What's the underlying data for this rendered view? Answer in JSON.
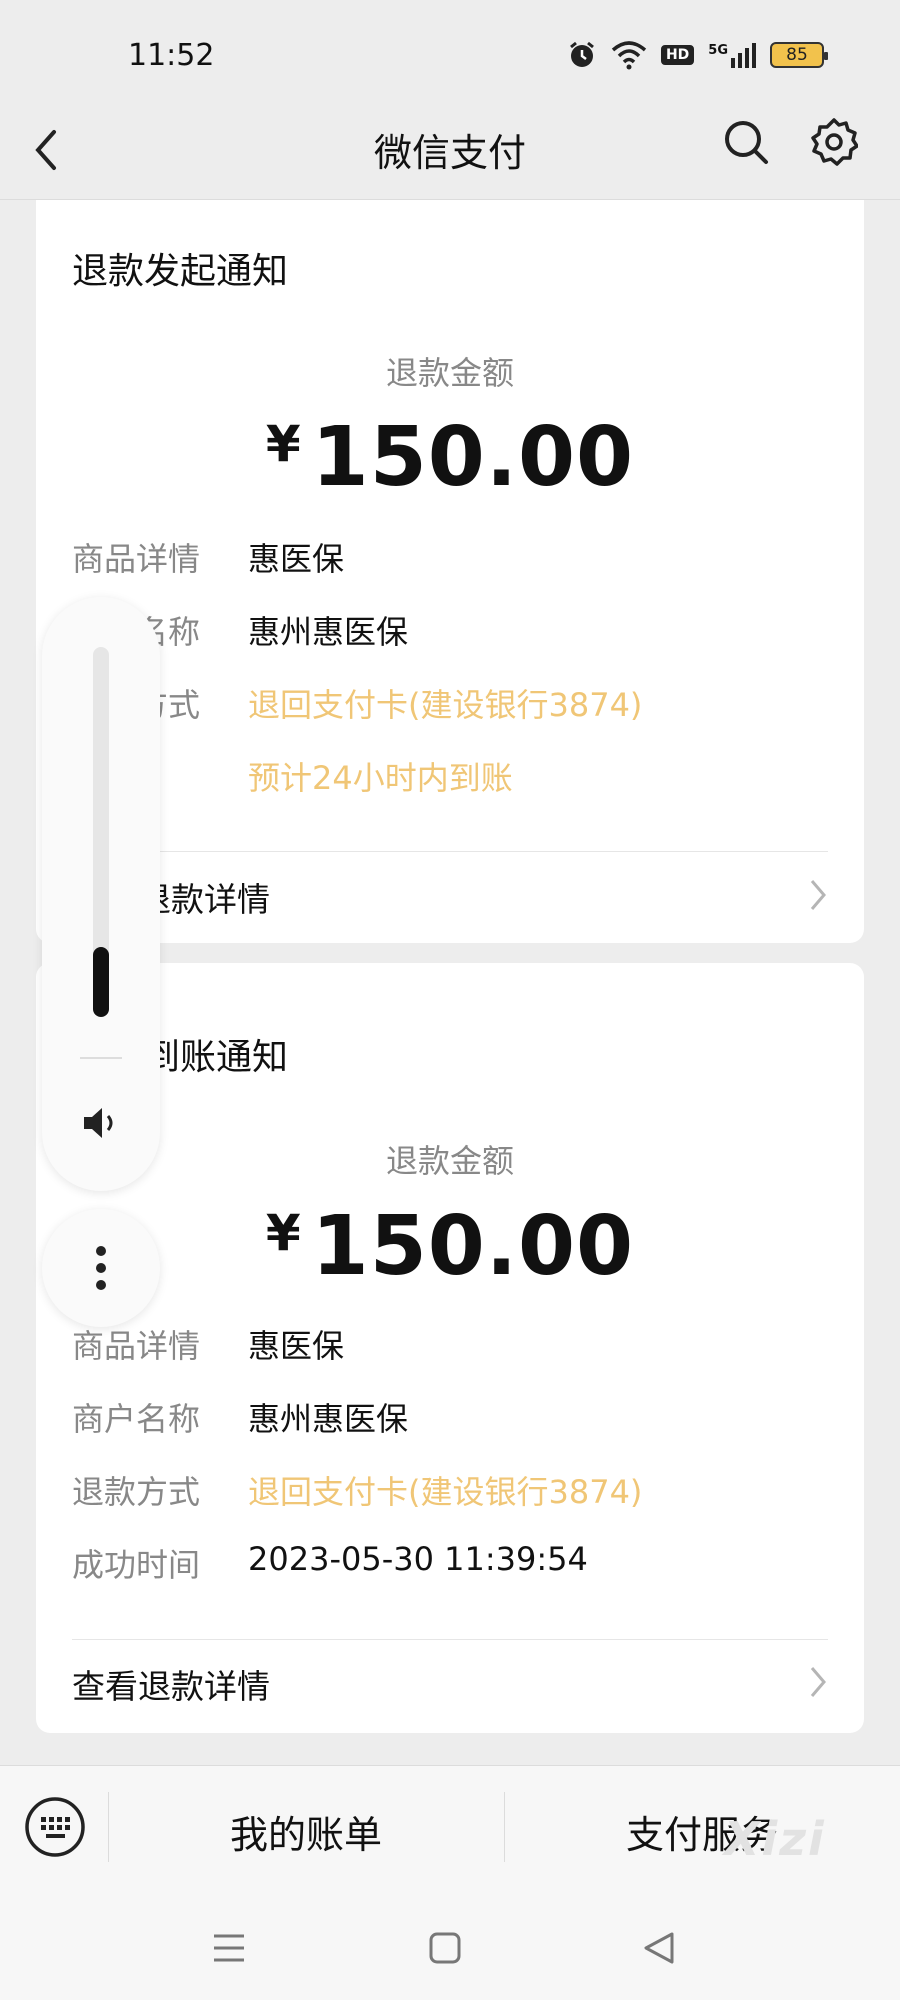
{
  "status_bar": {
    "time": "11:52",
    "battery": "85",
    "network": "5G",
    "hd_label": "HD"
  },
  "nav": {
    "title": "微信支付"
  },
  "cards": [
    {
      "title": "退款发起通知",
      "amount_label": "退款金额",
      "currency": "¥",
      "amount": "150.00",
      "rows": [
        {
          "key": "商品详情",
          "value": "惠医保"
        },
        {
          "key": "商户名称",
          "value": "惠州惠医保"
        },
        {
          "key": "退款方式",
          "value": "退回支付卡(建设银行3874)"
        },
        {
          "key": "",
          "value": "预计24小时内到账"
        }
      ],
      "link": "查看退款详情"
    },
    {
      "title": "退款到账通知",
      "amount_label": "退款金额",
      "currency": "¥",
      "amount": "150.00",
      "rows": [
        {
          "key": "商品详情",
          "value": "惠医保"
        },
        {
          "key": "商户名称",
          "value": "惠州惠医保"
        },
        {
          "key": "退款方式",
          "value": "退回支付卡(建设银行3874)"
        },
        {
          "key": "成功时间",
          "value": "2023-05-30 11:39:54"
        }
      ],
      "link": "查看退款详情"
    }
  ],
  "volume_overlay": {
    "level": 0.19
  },
  "bottom_bar": {
    "items": [
      "我的账单",
      "支付服务"
    ]
  },
  "watermark": "Xizi",
  "colors": {
    "background": "#ededed",
    "card": "#ffffff",
    "accent_orange": "#f0c676",
    "muted": "#888888"
  }
}
